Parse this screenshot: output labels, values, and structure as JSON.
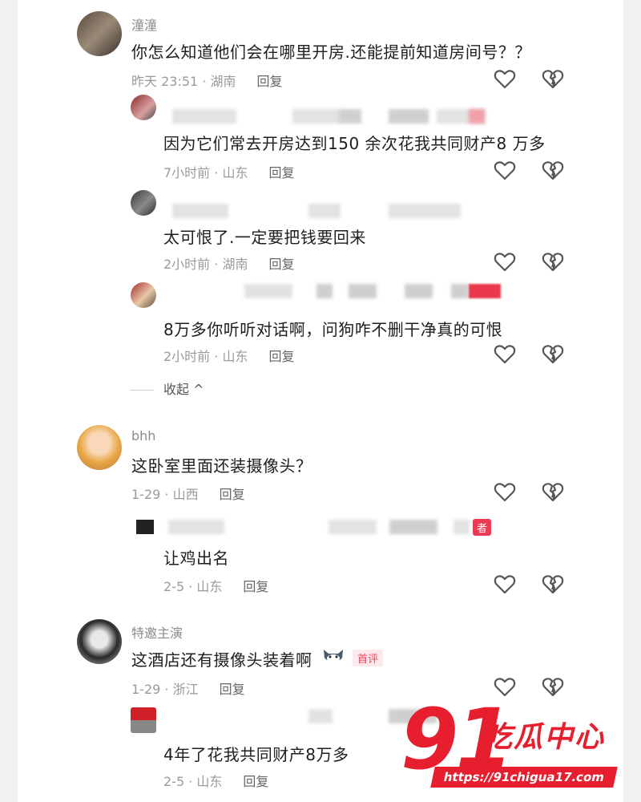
{
  "comments": [
    {
      "user": "潼潼",
      "text": "你怎么知道他们会在哪里开房.还能提前知道房间号？？",
      "meta": "昨天 23:51 · 湖南",
      "reply_label": "回复",
      "replies": [
        {
          "text": "因为它们常去开房达到150 余次花我共同财产8 万多",
          "meta": "7小时前 · 山东",
          "reply_label": "回复"
        },
        {
          "text": "太可恨了.一定要把钱要回来",
          "meta": "2小时前 · 湖南",
          "reply_label": "回复"
        },
        {
          "text": "8万多你听听对话啊，问狗咋不删干净真的可恨",
          "meta": "2小时前 · 山东",
          "reply_label": "回复"
        }
      ],
      "collapse_label": "收起 ^"
    },
    {
      "user": "bhh",
      "text": "这卧室里面还装摄像头？",
      "meta": "1-29 · 山西",
      "reply_label": "回复",
      "replies": [
        {
          "author_tag": "者",
          "text": "让鸡出名",
          "meta": "2-5 · 山东",
          "reply_label": "回复"
        }
      ]
    },
    {
      "user": "特邀主演",
      "text": "这酒店还有摄像头装着啊",
      "first_tag": "首评",
      "meta": "1-29 · 浙江",
      "reply_label": "回复",
      "replies": [
        {
          "text": "4年了花我共同财产8万多",
          "meta": "2-5 · 山东",
          "reply_label": "回复"
        }
      ]
    }
  ],
  "watermark": {
    "number": "91",
    "name": "吃瓜中心",
    "url": "https://91chigua17.com"
  },
  "colors": {
    "accent": "#e61e2d",
    "meta": "#9a9a9a"
  }
}
